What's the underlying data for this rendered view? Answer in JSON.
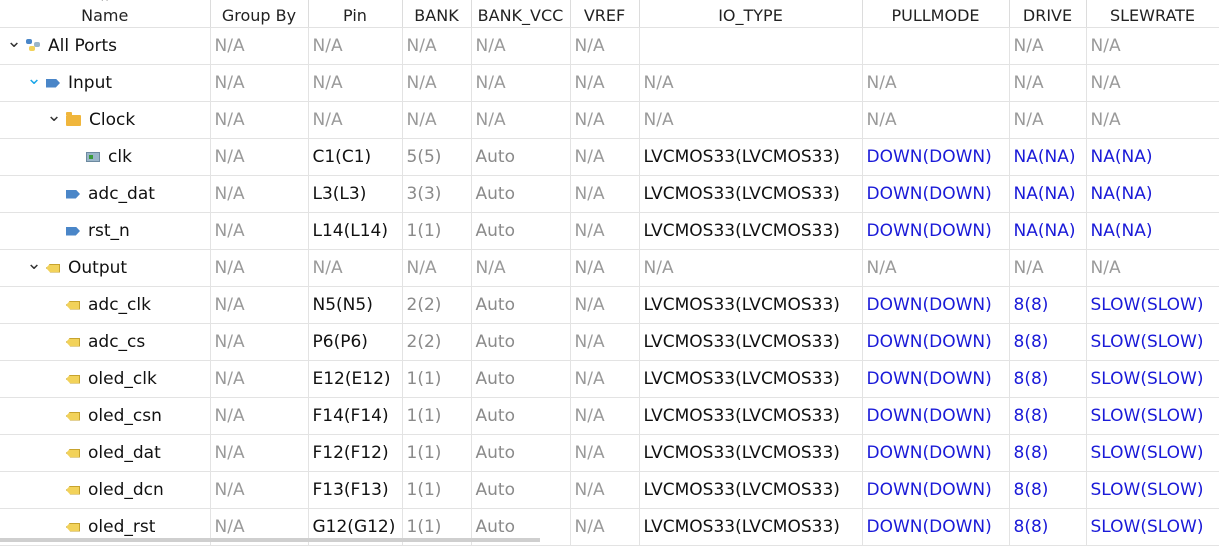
{
  "columns": [
    "Name",
    "Group By",
    "Pin",
    "BANK",
    "BANK_VCC",
    "VREF",
    "IO_TYPE",
    "PULLMODE",
    "DRIVE",
    "SLEWRATE"
  ],
  "rows": [
    {
      "level": 0,
      "expand": "down",
      "icon": "all-ports-icon",
      "name": "All Ports",
      "cells": [
        "N/A",
        "N/A",
        "N/A",
        "N/A",
        "N/A",
        "",
        "",
        "N/A",
        "N/A"
      ]
    },
    {
      "level": 1,
      "expand": "down-blue",
      "icon": "input-port-icon",
      "name": "Input",
      "cells": [
        "N/A",
        "N/A",
        "N/A",
        "N/A",
        "N/A",
        "N/A",
        "N/A",
        "N/A",
        "N/A"
      ]
    },
    {
      "level": 2,
      "expand": "down",
      "icon": "folder-icon",
      "name": "Clock",
      "cells": [
        "N/A",
        "N/A",
        "N/A",
        "N/A",
        "N/A",
        "N/A",
        "N/A",
        "N/A",
        "N/A"
      ]
    },
    {
      "level": 3,
      "expand": "",
      "icon": "clock-port-icon",
      "name": "clk",
      "cells": [
        "N/A",
        "C1(C1)",
        "5(5)",
        "Auto",
        "N/A",
        "LVCMOS33(LVCMOS33)",
        "DOWN(DOWN)",
        "NA(NA)",
        "NA(NA)"
      ]
    },
    {
      "level": 2,
      "expand": "",
      "icon": "input-port-icon",
      "name": "adc_dat",
      "cells": [
        "N/A",
        "L3(L3)",
        "3(3)",
        "Auto",
        "N/A",
        "LVCMOS33(LVCMOS33)",
        "DOWN(DOWN)",
        "NA(NA)",
        "NA(NA)"
      ]
    },
    {
      "level": 2,
      "expand": "",
      "icon": "input-port-icon",
      "name": "rst_n",
      "cells": [
        "N/A",
        "L14(L14)",
        "1(1)",
        "Auto",
        "N/A",
        "LVCMOS33(LVCMOS33)",
        "DOWN(DOWN)",
        "NA(NA)",
        "NA(NA)"
      ]
    },
    {
      "level": 1,
      "expand": "down",
      "icon": "output-port-icon",
      "name": "Output",
      "cells": [
        "N/A",
        "N/A",
        "N/A",
        "N/A",
        "N/A",
        "N/A",
        "N/A",
        "N/A",
        "N/A"
      ]
    },
    {
      "level": 2,
      "expand": "",
      "icon": "output-port-icon",
      "name": "adc_clk",
      "cells": [
        "N/A",
        "N5(N5)",
        "2(2)",
        "Auto",
        "N/A",
        "LVCMOS33(LVCMOS33)",
        "DOWN(DOWN)",
        "8(8)",
        "SLOW(SLOW)"
      ]
    },
    {
      "level": 2,
      "expand": "",
      "icon": "output-port-icon",
      "name": "adc_cs",
      "cells": [
        "N/A",
        "P6(P6)",
        "2(2)",
        "Auto",
        "N/A",
        "LVCMOS33(LVCMOS33)",
        "DOWN(DOWN)",
        "8(8)",
        "SLOW(SLOW)"
      ]
    },
    {
      "level": 2,
      "expand": "",
      "icon": "output-port-icon",
      "name": "oled_clk",
      "cells": [
        "N/A",
        "E12(E12)",
        "1(1)",
        "Auto",
        "N/A",
        "LVCMOS33(LVCMOS33)",
        "DOWN(DOWN)",
        "8(8)",
        "SLOW(SLOW)"
      ]
    },
    {
      "level": 2,
      "expand": "",
      "icon": "output-port-icon",
      "name": "oled_csn",
      "cells": [
        "N/A",
        "F14(F14)",
        "1(1)",
        "Auto",
        "N/A",
        "LVCMOS33(LVCMOS33)",
        "DOWN(DOWN)",
        "8(8)",
        "SLOW(SLOW)"
      ]
    },
    {
      "level": 2,
      "expand": "",
      "icon": "output-port-icon",
      "name": "oled_dat",
      "cells": [
        "N/A",
        "F12(F12)",
        "1(1)",
        "Auto",
        "N/A",
        "LVCMOS33(LVCMOS33)",
        "DOWN(DOWN)",
        "8(8)",
        "SLOW(SLOW)"
      ]
    },
    {
      "level": 2,
      "expand": "",
      "icon": "output-port-icon",
      "name": "oled_dcn",
      "cells": [
        "N/A",
        "F13(F13)",
        "1(1)",
        "Auto",
        "N/A",
        "LVCMOS33(LVCMOS33)",
        "DOWN(DOWN)",
        "8(8)",
        "SLOW(SLOW)"
      ]
    },
    {
      "level": 2,
      "expand": "",
      "icon": "output-port-icon",
      "name": "oled_rst",
      "cells": [
        "N/A",
        "G12(G12)",
        "1(1)",
        "Auto",
        "N/A",
        "LVCMOS33(LVCMOS33)",
        "DOWN(DOWN)",
        "8(8)",
        "SLOW(SLOW)"
      ]
    }
  ],
  "colors": {
    "editable_value": "#1a1ad8",
    "na_value": "#9a9a9a",
    "expand_accent": "#1aa6e8"
  }
}
